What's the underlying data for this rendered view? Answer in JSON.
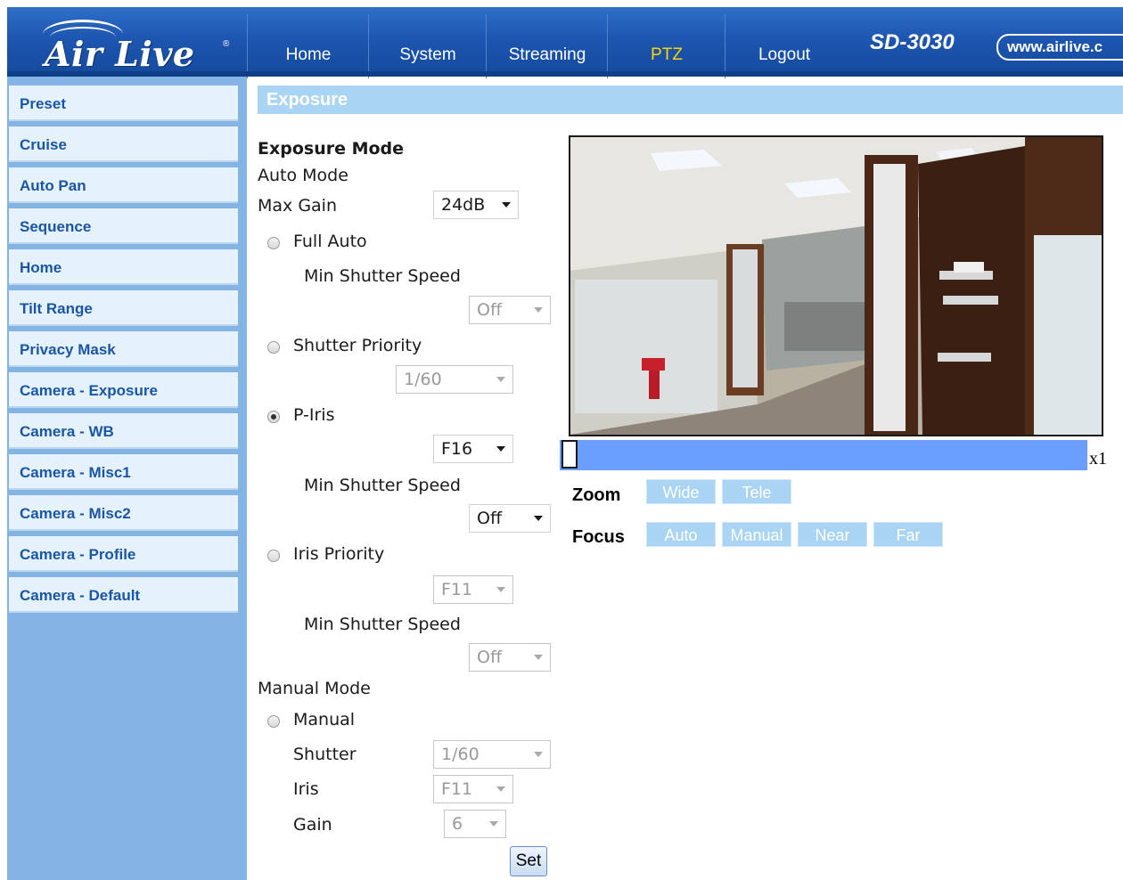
{
  "header": {
    "logo_text": "Air Live",
    "logo_mark": "®",
    "nav": [
      {
        "label": "Home",
        "active": false
      },
      {
        "label": "System",
        "active": false
      },
      {
        "label": "Streaming",
        "active": false
      },
      {
        "label": "PTZ",
        "active": true
      },
      {
        "label": "Logout",
        "active": false
      }
    ],
    "model": "SD-3030",
    "website": "www.airlive.c"
  },
  "sidebar": {
    "items": [
      {
        "label": "Preset"
      },
      {
        "label": "Cruise"
      },
      {
        "label": "Auto Pan"
      },
      {
        "label": "Sequence"
      },
      {
        "label": "Home"
      },
      {
        "label": "Tilt Range"
      },
      {
        "label": "Privacy Mask"
      },
      {
        "label": "Camera - Exposure"
      },
      {
        "label": "Camera - WB"
      },
      {
        "label": "Camera - Misc1"
      },
      {
        "label": "Camera - Misc2"
      },
      {
        "label": "Camera - Profile"
      },
      {
        "label": "Camera - Default"
      }
    ]
  },
  "section_title": "Exposure",
  "form": {
    "exposure_mode_label": "Exposure Mode",
    "auto_mode_label": "Auto Mode",
    "max_gain_label": "Max Gain",
    "max_gain_value": "24dB",
    "full_auto_label": "Full Auto",
    "full_auto_min_shutter_label": "Min Shutter Speed",
    "full_auto_min_shutter_value": "Off",
    "shutter_priority_label": "Shutter Priority",
    "shutter_priority_value": "1/60",
    "p_iris_label": "P-Iris",
    "p_iris_value": "F16",
    "p_iris_min_shutter_label": "Min Shutter Speed",
    "p_iris_min_shutter_value": "Off",
    "iris_priority_label": "Iris Priority",
    "iris_priority_value": "F11",
    "iris_priority_min_shutter_label": "Min Shutter Speed",
    "iris_priority_min_shutter_value": "Off",
    "manual_mode_label": "Manual Mode",
    "manual_label": "Manual",
    "shutter_label": "Shutter",
    "shutter_value": "1/60",
    "iris_label": "Iris",
    "iris_value": "F11",
    "gain_label": "Gain",
    "gain_value": "6",
    "set_label": "Set",
    "selected_mode": "P-Iris"
  },
  "ptz": {
    "zoom_level": "x1",
    "zoom_label": "Zoom",
    "zoom_buttons": [
      "Wide",
      "Tele"
    ],
    "focus_label": "Focus",
    "focus_buttons": [
      "Auto",
      "Manual",
      "Near",
      "Far"
    ]
  },
  "colors": {
    "header_blue": "#1d56b0",
    "sidebar_blue": "#84b4e4",
    "sidebar_item_bg": "#e6f2fb",
    "sidebar_text": "#1a56a6",
    "title_bar": "#a9d4f3",
    "active_nav": "#ffd700",
    "zoom_bar": "#6b9fff"
  }
}
